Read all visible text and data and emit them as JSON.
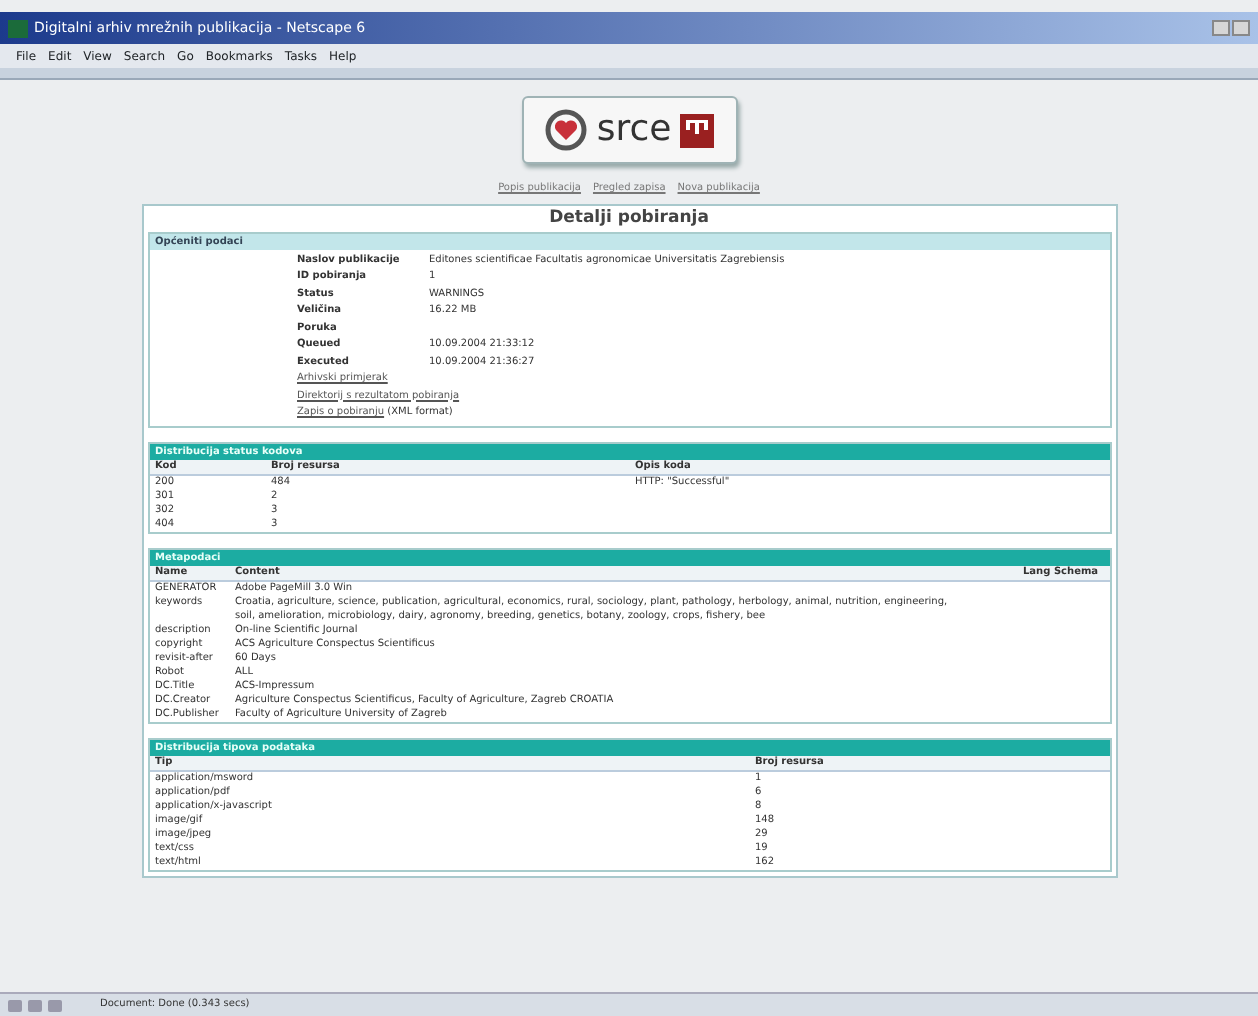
{
  "window": {
    "title": "Digitalni arhiv mrežnih publikacija - Netscape 6"
  },
  "menu": [
    "File",
    "Edit",
    "View",
    "Search",
    "Go",
    "Bookmarks",
    "Tasks",
    "Help"
  ],
  "logo": {
    "text": "srce"
  },
  "nav_links": [
    "Popis publikacija",
    "Pregled zapisa",
    "Nova publikacija"
  ],
  "page_title": "Detalji pobiranja",
  "general": {
    "title": "Općeniti podaci",
    "fields": [
      {
        "label": "Naslov publikacije",
        "value": "Editones scientificae Facultatis agronomicae Universitatis Zagrebiensis"
      },
      {
        "label": "ID pobiranja",
        "value": "1"
      },
      {
        "label": "Status",
        "value": "WARNINGS"
      },
      {
        "label": "Veličina",
        "value": "16.22 MB"
      },
      {
        "label": "Poruka"
      },
      {
        "label": "Queued",
        "value": "10.09.2004 21:33:12"
      },
      {
        "label": "Executed",
        "value": "10.09.2004 21:36:27"
      }
    ],
    "links": [
      {
        "text": "Arhivski primjerak"
      },
      {
        "text": "Direktorij s rezultatom pobiranja"
      },
      {
        "text": "Zapis o pobiranju",
        "note": "(XML format)"
      }
    ]
  },
  "status_codes": {
    "title": "Distribucija status kodova",
    "columns": [
      "Kod",
      "Broj resursa",
      "Opis koda"
    ],
    "rows": [
      [
        "200",
        "484",
        "HTTP: \"Successful\""
      ],
      [
        "301",
        "2"
      ],
      [
        "302",
        "3"
      ],
      [
        "404",
        "3"
      ]
    ]
  },
  "metadata": {
    "title": "Metapodaci",
    "columns": [
      "Name",
      "Content",
      "Lang Schema"
    ],
    "rows": [
      [
        "GENERATOR",
        "Adobe PageMill 3.0 Win"
      ],
      [
        "keywords",
        "Croatia, agriculture, science, publication, agricultural, economics, rural, sociology, plant, pathology, herbology, animal, nutrition, engineering, soil, amelioration, microbiology, dairy, agronomy, breeding, genetics, botany, zoology, crops, fishery, bee"
      ],
      [
        "description",
        "On-line Scientific Journal"
      ],
      [
        "copyright",
        "ACS Agriculture Conspectus Scientificus"
      ],
      [
        "revisit-after",
        "60 Days"
      ],
      [
        "Robot",
        "ALL"
      ],
      [
        "DC.Title",
        "ACS-Impressum"
      ],
      [
        "DC.Creator",
        "Agriculture Conspectus Scientificus, Faculty of Agriculture, Zagreb CROATIA"
      ],
      [
        "DC.Publisher",
        "Faculty of Agriculture University of Zagreb"
      ]
    ]
  },
  "mime_types": {
    "title": "Distribucija tipova podataka",
    "columns": [
      "Tip",
      "Broj resursa"
    ],
    "rows": [
      [
        "application/msword",
        "1"
      ],
      [
        "application/pdf",
        "6"
      ],
      [
        "application/x-javascript",
        "8"
      ],
      [
        "image/gif",
        "148"
      ],
      [
        "image/jpeg",
        "29"
      ],
      [
        "text/css",
        "19"
      ],
      [
        "text/html",
        "162"
      ]
    ]
  },
  "status_bar": {
    "text": "Document: Done (0.343 secs)"
  }
}
